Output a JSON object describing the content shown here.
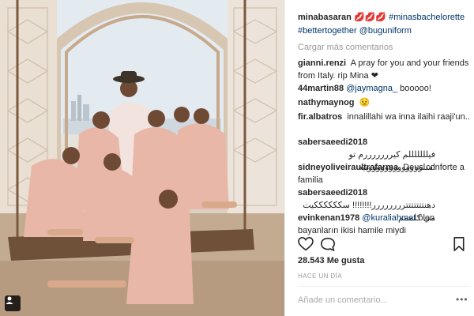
{
  "post": {
    "caption": {
      "username": "minabasaran",
      "emoji": "💋💋💋",
      "tag1": "#minasbachelorette",
      "tag2": "#bettertogether",
      "mention": "@buguniform"
    },
    "load_more_label": "Cargar más comentarios",
    "comments": [
      {
        "user": "gianni.renzi",
        "text": "A pray for you and your friends from Italy. rip Mina ❤"
      },
      {
        "user": "44martin88",
        "mention": "@jaymagna_",
        "text": " booooo!"
      },
      {
        "user": "nathymaynog",
        "text": "😟"
      },
      {
        "user": "fir.albatros",
        "text": "innalillahi wa inna ilaihi raaji'un.."
      },
      {
        "user": "sabersaeedi2018",
        "text": "فيلللللللم كيرررررررم تو اسلوووووووووووووييه"
      },
      {
        "user": "sidneyoliveiraultrafarma",
        "text": "Deus conforte a familia"
      },
      {
        "user": "sabersaeedi2018",
        "text": "دهنتتتتتتترررررررر!!!!!!!! سككككككيت مي كلممم"
      },
      {
        "user": "evinkenan1978",
        "mention": "@kuraliahmet",
        "text": " ölen bayanların ikisi hamile miydi"
      }
    ],
    "likes": "28.543 Me gusta",
    "time": "HACE UN DÍA",
    "add_comment_placeholder": "Añade un comentario...",
    "more_label": "•••"
  },
  "icons": {
    "like": "heart-icon",
    "comment": "comment-icon",
    "save": "bookmark-icon",
    "photo_user": "user-tag-icon"
  },
  "colors": {
    "link": "#003569",
    "muted": "#999999",
    "text": "#262626"
  }
}
